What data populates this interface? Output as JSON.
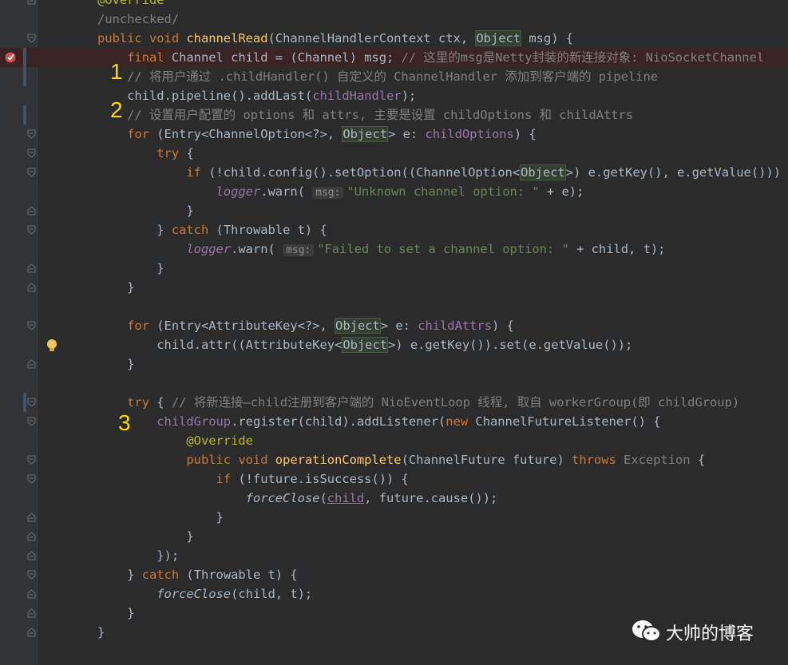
{
  "editor": {
    "lines": [
      {
        "segs": [
          {
            "t": "@Override",
            "c": "an"
          }
        ]
      },
      {
        "segs": [
          {
            "t": "/unchecked/",
            "c": "cm"
          }
        ]
      },
      {
        "segs": [
          {
            "t": "public void ",
            "c": "kw"
          },
          {
            "t": "channelRead",
            "c": "fn"
          },
          {
            "t": "(ChannelHandlerContext ctx, "
          },
          {
            "t": "Object",
            "c": "bx"
          },
          {
            "t": " msg) {"
          }
        ]
      },
      {
        "segs": [
          {
            "t": "    final ",
            "c": "kw"
          },
          {
            "t": "Channel child = (Channel) msg; "
          },
          {
            "t": "// 这里的msg是Netty封装的新连接对象: NioSocketChannel",
            "c": "cm"
          }
        ]
      },
      {
        "segs": [
          {
            "t": "    // 将用户通过 .childHandler() 自定义的 ChannelHandler 添加到客户端的 pipeline",
            "c": "cm"
          }
        ]
      },
      {
        "segs": [
          {
            "t": "    child.pipeline().addLast("
          },
          {
            "t": "childHandler",
            "c": "fld"
          },
          {
            "t": ");"
          }
        ]
      },
      {
        "segs": [
          {
            "t": "    // 设置用户配置的 options 和 attrs, 主要是设置 childOptions 和 childAttrs",
            "c": "cm"
          }
        ]
      },
      {
        "segs": [
          {
            "t": "    for ",
            "c": "kw"
          },
          {
            "t": "(Entry<ChannelOption<?>, "
          },
          {
            "t": "Object",
            "c": "bx"
          },
          {
            "t": "> e: "
          },
          {
            "t": "childOptions",
            "c": "fld"
          },
          {
            "t": ") {"
          }
        ]
      },
      {
        "segs": [
          {
            "t": "        try ",
            "c": "kw"
          },
          {
            "t": "{"
          }
        ]
      },
      {
        "segs": [
          {
            "t": "            if ",
            "c": "kw"
          },
          {
            "t": "(!child.config().setOption((ChannelOption<"
          },
          {
            "t": "Object",
            "c": "bx"
          },
          {
            "t": ">) e.getKey(), e.getValue()))"
          }
        ]
      },
      {
        "segs": [
          {
            "t": "                "
          },
          {
            "t": "logger",
            "c": "fld it"
          },
          {
            "t": ".warn( "
          },
          {
            "t": "msg:",
            "c": "hint"
          },
          {
            "t": "\"Unknown channel option: \"",
            "c": "str"
          },
          {
            "t": " + e);"
          }
        ]
      },
      {
        "segs": [
          {
            "t": "            }"
          }
        ]
      },
      {
        "segs": [
          {
            "t": "        } "
          },
          {
            "t": "catch ",
            "c": "kw"
          },
          {
            "t": "(Throwable t) {"
          }
        ]
      },
      {
        "segs": [
          {
            "t": "            "
          },
          {
            "t": "logger",
            "c": "fld it"
          },
          {
            "t": ".warn( "
          },
          {
            "t": "msg:",
            "c": "hint"
          },
          {
            "t": "\"Failed to set a channel option: \"",
            "c": "str"
          },
          {
            "t": " + child, t);"
          }
        ]
      },
      {
        "segs": [
          {
            "t": "        }"
          }
        ]
      },
      {
        "segs": [
          {
            "t": "    }"
          }
        ]
      },
      {
        "segs": [
          {
            "t": ""
          }
        ]
      },
      {
        "segs": [
          {
            "t": "    for ",
            "c": "kw"
          },
          {
            "t": "(Entry<AttributeKey<?>, "
          },
          {
            "t": "Object",
            "c": "bx"
          },
          {
            "t": "> e: "
          },
          {
            "t": "childAttrs",
            "c": "fld"
          },
          {
            "t": ") {"
          }
        ]
      },
      {
        "segs": [
          {
            "t": "        child.attr((AttributeKey<"
          },
          {
            "t": "Object",
            "c": "bx"
          },
          {
            "t": ">) e.getKey()).set(e.getValue());"
          }
        ]
      },
      {
        "segs": [
          {
            "t": "    }"
          }
        ]
      },
      {
        "segs": [
          {
            "t": ""
          }
        ]
      },
      {
        "segs": [
          {
            "t": "    try ",
            "c": "kw"
          },
          {
            "t": "{ "
          },
          {
            "t": "// 将新连接—child注册到客户端的 NioEventLoop 线程, 取自 workerGroup(即 childGroup)",
            "c": "cm"
          }
        ]
      },
      {
        "segs": [
          {
            "t": "        "
          },
          {
            "t": "childGroup",
            "c": "fld"
          },
          {
            "t": ".register(child).addListener("
          },
          {
            "t": "new ",
            "c": "kw"
          },
          {
            "t": "ChannelFutureListener() {"
          }
        ]
      },
      {
        "segs": [
          {
            "t": "            @Override",
            "c": "an"
          }
        ]
      },
      {
        "segs": [
          {
            "t": "            public void ",
            "c": "kw"
          },
          {
            "t": "operationComplete",
            "c": "fn"
          },
          {
            "t": "(ChannelFuture future) "
          },
          {
            "t": "throws ",
            "c": "kw"
          },
          {
            "t": "Exception",
            "c": "cm"
          },
          {
            "t": " {"
          }
        ]
      },
      {
        "segs": [
          {
            "t": "                if ",
            "c": "kw"
          },
          {
            "t": "(!future.isSuccess()) {"
          }
        ]
      },
      {
        "segs": [
          {
            "t": "                    "
          },
          {
            "t": "forceClose",
            "c": "it"
          },
          {
            "t": "("
          },
          {
            "t": "child",
            "c": "fld ul"
          },
          {
            "t": ", future.cause());"
          }
        ]
      },
      {
        "segs": [
          {
            "t": "                }"
          }
        ]
      },
      {
        "segs": [
          {
            "t": "            }"
          }
        ]
      },
      {
        "segs": [
          {
            "t": "        });"
          }
        ]
      },
      {
        "segs": [
          {
            "t": "    } "
          },
          {
            "t": "catch ",
            "c": "kw"
          },
          {
            "t": "(Throwable t) {"
          }
        ]
      },
      {
        "segs": [
          {
            "t": "        "
          },
          {
            "t": "forceClose",
            "c": "it"
          },
          {
            "t": "(child, t);"
          }
        ]
      },
      {
        "segs": [
          {
            "t": "    }"
          }
        ]
      },
      {
        "segs": [
          {
            "t": "}"
          }
        ]
      }
    ]
  },
  "annotations": {
    "one": "1",
    "two": "2",
    "three": "3"
  },
  "watermark": {
    "text": "大帅的博客",
    "icon": "wechat-icon"
  },
  "colors": {
    "background": "#2b2b2b",
    "keyword": "#cc7832",
    "function": "#ffc66d",
    "field": "#9876aa",
    "string": "#6a8759",
    "comment": "#808080",
    "marker": "#ffd800"
  }
}
